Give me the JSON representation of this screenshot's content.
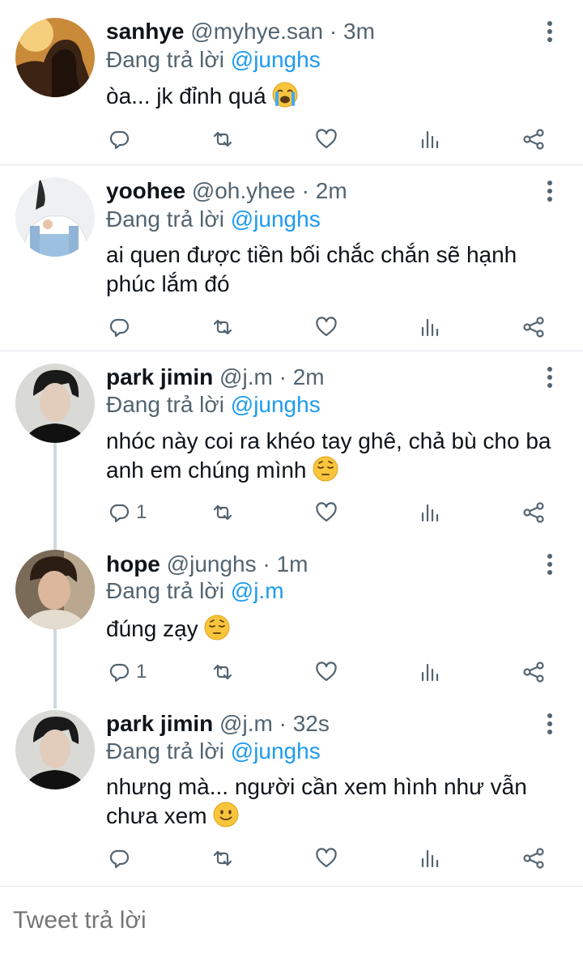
{
  "tweets": [
    {
      "name": "sanhye",
      "handle": "@myhye.san",
      "separator": "·",
      "time": "3m",
      "reply_prefix": "Đang trả lời",
      "reply_to": "@junghs",
      "text": "òa... jk đỉnh quá",
      "emoji": "loudly-crying-face",
      "reply_count": "",
      "avatar": "avatar-woman-silhouette-sunset"
    },
    {
      "name": "yoohee",
      "handle": "@oh.yhee",
      "separator": "·",
      "time": "2m",
      "reply_prefix": "Đang trả lời",
      "reply_to": "@junghs",
      "text": "ai quen được tiền bối chắc chắn sẽ hạnh phúc lắm đó",
      "emoji": "",
      "reply_count": "",
      "avatar": "avatar-girl-overalls"
    },
    {
      "name": "park jimin",
      "handle": "@j.m",
      "separator": "·",
      "time": "2m",
      "reply_prefix": "Đang trả lời",
      "reply_to": "@junghs",
      "text": "nhóc này coi ra khéo tay ghê, chả bù cho ba anh em chúng mình",
      "emoji": "pensive-face",
      "reply_count": "1",
      "avatar": "avatar-man-dark-hair"
    },
    {
      "name": "hope",
      "handle": "@junghs",
      "separator": "·",
      "time": "1m",
      "reply_prefix": "Đang trả lời",
      "reply_to": "@j.m",
      "text": "đúng zạy",
      "emoji": "pensive-face",
      "reply_count": "1",
      "avatar": "avatar-man-selfie"
    },
    {
      "name": "park jimin",
      "handle": "@j.m",
      "separator": "·",
      "time": "32s",
      "reply_prefix": "Đang trả lời",
      "reply_to": "@junghs",
      "text": "nhưng mà... người cần xem hình như vẫn chưa xem",
      "emoji": "slightly-smiling-face",
      "reply_count": "",
      "avatar": "avatar-man-dark-hair"
    }
  ],
  "actions": {
    "reply_icon": "reply-icon",
    "retweet_icon": "retweet-icon",
    "like_icon": "heart-icon",
    "analytics_icon": "analytics-icon",
    "share_icon": "share-icon",
    "menu_icon": "more-vertical-icon"
  },
  "composer": {
    "placeholder": "Tweet trả lời"
  },
  "colors": {
    "mention": "#1d9bf0",
    "secondary": "#536471",
    "primary": "#0f1419",
    "thread_line": "#cfd9de"
  }
}
